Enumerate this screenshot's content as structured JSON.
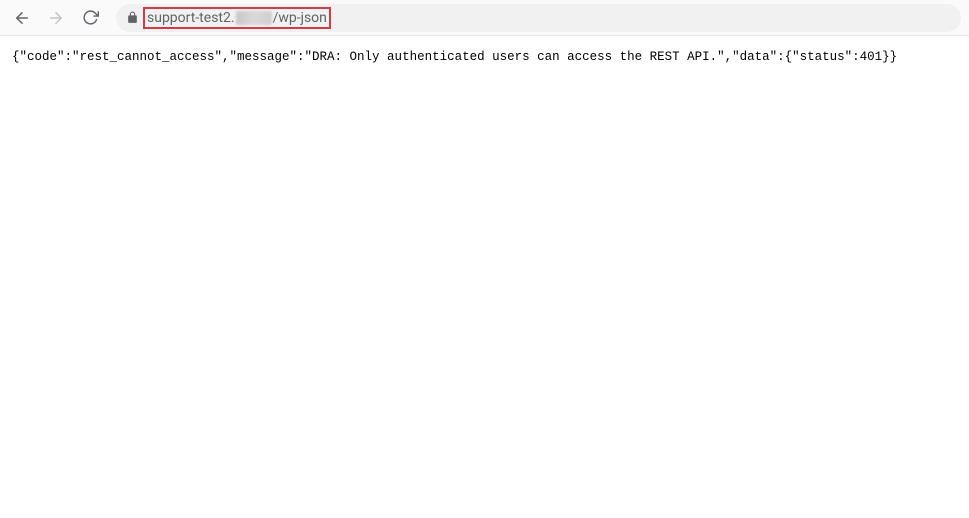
{
  "browser": {
    "url_prefix": "support-test2.",
    "url_suffix": "/wp-json"
  },
  "page": {
    "body_text": "{\"code\":\"rest_cannot_access\",\"message\":\"DRA: Only authenticated users can access the REST API.\",\"data\":{\"status\":401}}"
  }
}
